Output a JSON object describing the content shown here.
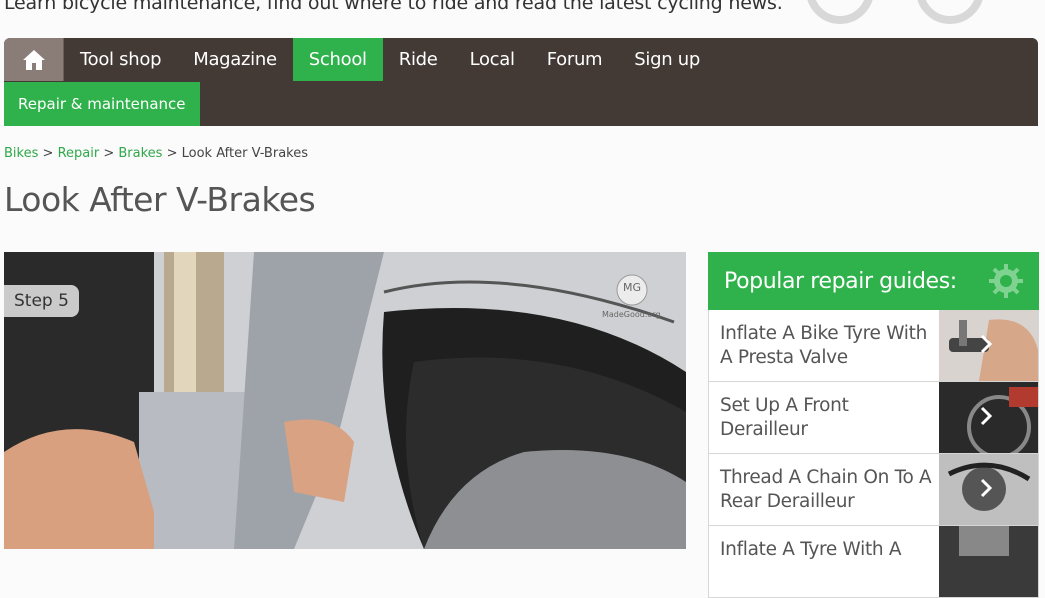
{
  "header": {
    "tagline": "Learn bicycle maintenance, find out where to ride and read the latest cycling news."
  },
  "nav": {
    "home_icon": "home-icon",
    "items": [
      {
        "label": "Tool shop",
        "active": false
      },
      {
        "label": "Magazine",
        "active": false
      },
      {
        "label": "School",
        "active": true
      },
      {
        "label": "Ride",
        "active": false
      },
      {
        "label": "Local",
        "active": false
      },
      {
        "label": "Forum",
        "active": false
      },
      {
        "label": "Sign up",
        "active": false
      }
    ],
    "subnav_label": "Repair & maintenance"
  },
  "breadcrumb": {
    "items": [
      "Bikes",
      "Repair",
      "Brakes"
    ],
    "separator": ">",
    "current": "Look After V-Brakes"
  },
  "article": {
    "title": "Look After V-Brakes",
    "step_label": "Step 5",
    "photo_watermark": "MadeGood.org",
    "photo_logo": "MG"
  },
  "sidebar": {
    "title": "Popular repair guides:",
    "title_icon": "gear-icon",
    "guides": [
      {
        "label": "Inflate A Bike Tyre With A Presta Valve"
      },
      {
        "label": "Set Up A Front Derailleur"
      },
      {
        "label": "Thread A Chain On To A Rear Derailleur"
      },
      {
        "label": "Inflate A Tyre With A"
      }
    ]
  },
  "colors": {
    "accent_green": "#2fb24c",
    "nav_brown": "#433935",
    "home_tab": "#8a7d77"
  }
}
